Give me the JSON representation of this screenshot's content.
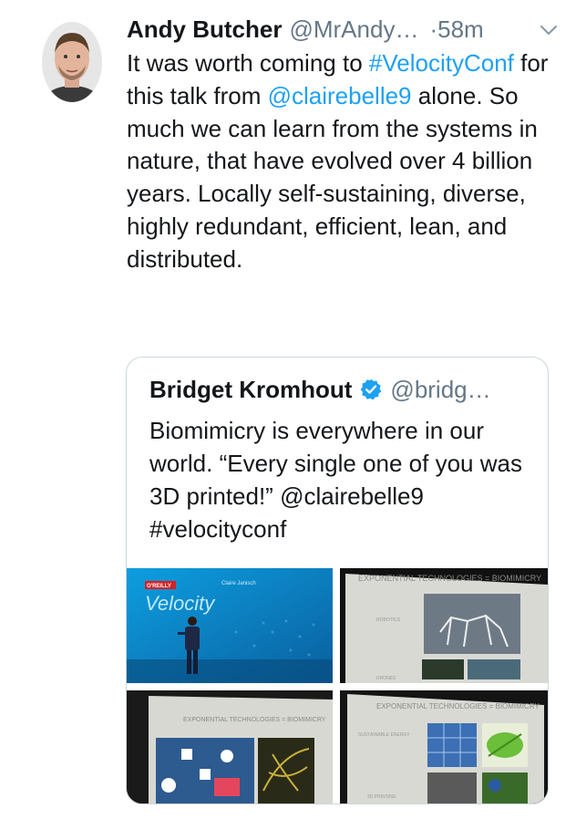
{
  "tweet": {
    "display_name": "Andy Butcher",
    "handle": "@MrAndy…",
    "separator": "·",
    "timestamp": "58m",
    "text_parts": [
      {
        "text": "It was worth coming to ",
        "link": false
      },
      {
        "text": "#VelocityConf",
        "link": true
      },
      {
        "text": " for this talk from ",
        "link": false
      },
      {
        "text": "@clairebelle9",
        "link": true
      },
      {
        "text": " alone. So much we can learn from the systems in nature, that have evolved over 4 billion years. Locally self-sustaining, diverse, highly redundant, efficient, lean, and distributed.",
        "link": false
      }
    ]
  },
  "quoted": {
    "display_name": "Bridget Kromhout",
    "handle": "@bridg…",
    "text": "Biomimicry is everywhere in our world. “Every single one of you was 3D printed!” @clairebelle9 #velocityconf",
    "media": {
      "m1": {
        "brand": "O'REILLY",
        "title": "Velocity",
        "speaker": "Claire Janisch"
      },
      "m2": {
        "heading": "EXPONENTIAL TECHNOLOGIES = BIOMIMICRY",
        "row1": "ROBOTICS",
        "row2": "DRONES"
      },
      "m3": {
        "heading": "EXPONENTIAL TECHNOLOGIES = BIOMIMICRY"
      },
      "m4": {
        "heading": "EXPONENTIAL TECHNOLOGIES = BIOMIMICRY",
        "row1": "SUSTAINABLE ENERGY",
        "row2": "3D PRINTING"
      }
    }
  },
  "colors": {
    "link": "#1da1f2",
    "secondary": "#657786",
    "verified": "#1da1f2",
    "border": "#ccd6dd"
  },
  "icons": [
    "avatar",
    "chevron-down-icon",
    "verified-badge-icon"
  ]
}
